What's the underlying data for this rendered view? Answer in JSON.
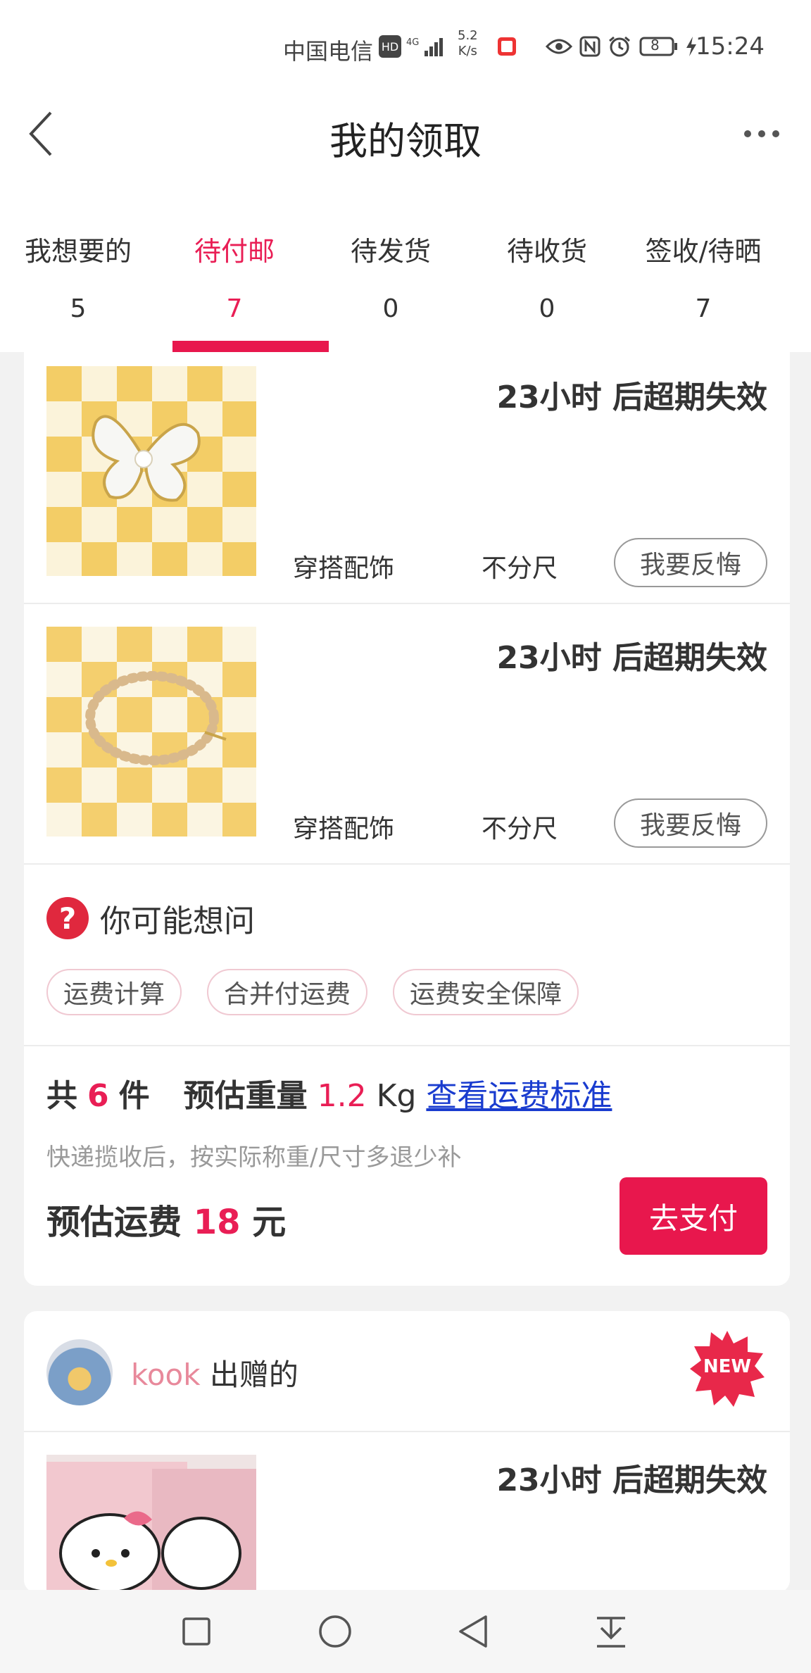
{
  "status_bar": {
    "carrier": "中国电信",
    "hd": "HD",
    "network": "4G",
    "speed_value": "5.2",
    "speed_unit": "K/s",
    "battery": "8",
    "time": "15:24"
  },
  "header": {
    "title": "我的领取"
  },
  "tabs": [
    {
      "label": "我想要的",
      "count": "5"
    },
    {
      "label": "待付邮",
      "count": "7",
      "active": true
    },
    {
      "label": "待发货",
      "count": "0"
    },
    {
      "label": "待收货",
      "count": "0"
    },
    {
      "label": "签收/待晒",
      "count": "7"
    }
  ],
  "items": [
    {
      "expire": "23小时 后超期失效",
      "category": "穿搭配饰",
      "size": "不分尺",
      "action": "我要反悔"
    },
    {
      "expire": "23小时 后超期失效",
      "category": "穿搭配饰",
      "size": "不分尺",
      "action": "我要反悔"
    }
  ],
  "faq": {
    "title": "你可能想问",
    "chips": [
      "运费计算",
      "合并付运费",
      "运费安全保障"
    ]
  },
  "summary": {
    "count_prefix": "共",
    "count": "6",
    "count_suffix": "件",
    "weight_label": "预估重量",
    "weight": "1.2",
    "weight_unit": "Kg",
    "link": "查看运费标准",
    "note": "快递揽收后，按实际称重/尺寸多退少补",
    "fee_label": "预估运费",
    "fee": "18",
    "fee_unit": "元",
    "pay_button": "去支付"
  },
  "second_card": {
    "giver_nick": "kook",
    "giver_suffix": "出赠的",
    "badge": "NEW",
    "item_expire": "23小时 后超期失效"
  },
  "colors": {
    "accent": "#e8174d",
    "link": "#1a3ccf"
  }
}
